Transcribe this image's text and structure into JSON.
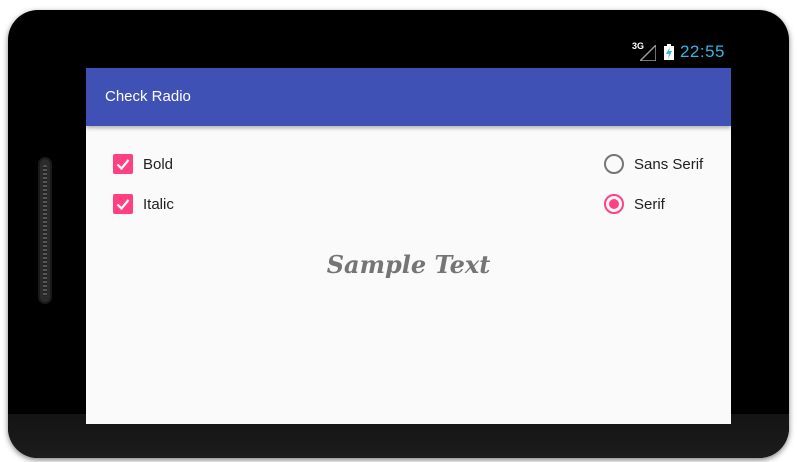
{
  "status_bar": {
    "network_label": "3G",
    "time": "22:55",
    "signal_icon": "signal-icon",
    "battery_icon": "battery-charging-icon"
  },
  "app_bar": {
    "title": "Check Radio"
  },
  "checkboxes": [
    {
      "label": "Bold",
      "checked": true
    },
    {
      "label": "Italic",
      "checked": true
    }
  ],
  "radios": [
    {
      "label": "Sans Serif",
      "checked": false
    },
    {
      "label": "Serif",
      "checked": true
    }
  ],
  "sample_text": "Sample Text",
  "colors": {
    "app_bar": "#3f51b5",
    "accent": "#ff4081",
    "status_text": "#33b5e5",
    "screen_background": "#fafafa",
    "sample_text": "#757575"
  }
}
